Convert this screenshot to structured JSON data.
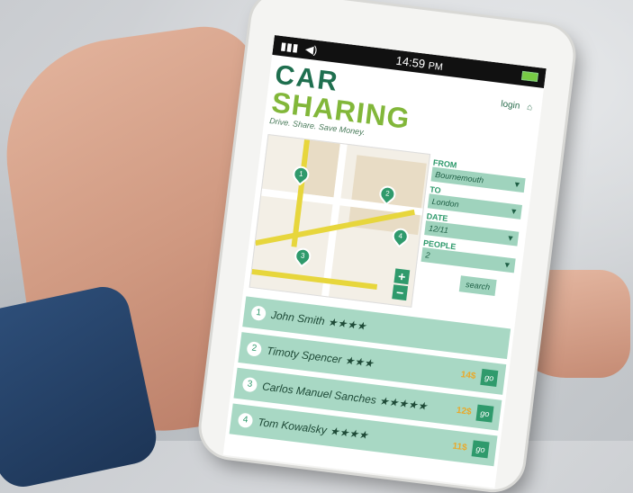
{
  "top_text": "sharing",
  "status": {
    "time": "14:59",
    "ampm": "PM"
  },
  "logo": {
    "line1": "CAR",
    "line2": "SHARING",
    "tagline": "Drive. Share. Save Money."
  },
  "topright": {
    "login": "login",
    "home_icon": "home-icon"
  },
  "map": {
    "pins": [
      "1",
      "2",
      "3",
      "4"
    ],
    "zoom_in": "+",
    "zoom_out": "−"
  },
  "form": {
    "from_label": "FROM",
    "from_value": "Bournemouth",
    "to_label": "TO",
    "to_value": "London",
    "date_label": "DATE",
    "date_value": "12/11",
    "people_label": "PEOPLE",
    "people_value": "2",
    "search": "search"
  },
  "results": [
    {
      "num": "1",
      "name": "John Smith",
      "stars": "★★★★",
      "price": "",
      "go": ""
    },
    {
      "num": "2",
      "name": "Timoty Spencer",
      "stars": "★★★",
      "price": "14$",
      "go": "go"
    },
    {
      "num": "3",
      "name": "Carlos Manuel Sanches",
      "stars": "★★★★★",
      "price": "12$",
      "go": "go"
    },
    {
      "num": "4",
      "name": "Tom Kowalsky",
      "stars": "★★★★",
      "price": "11$",
      "go": "go"
    }
  ],
  "colors": {
    "brand_dark": "#1f6f4f",
    "brand_light": "#82b73a",
    "accent": "#2f9a6c",
    "row": "#a8d8c4"
  }
}
